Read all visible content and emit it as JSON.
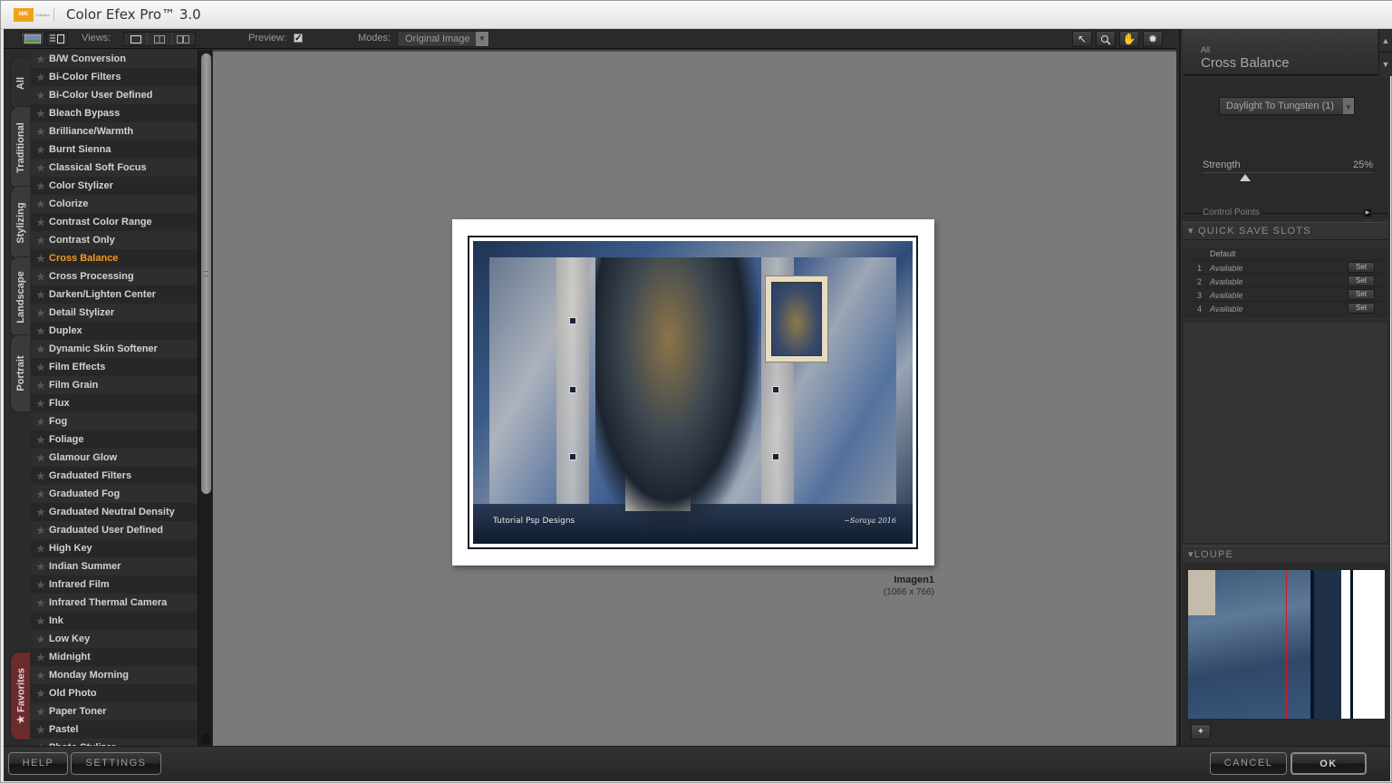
{
  "app": {
    "brand": "NIK",
    "brand_sub": "Software",
    "title": "Color Efex Pro™ 3.0"
  },
  "toolbar": {
    "views_label": "Views:",
    "preview_label": "Preview:",
    "preview_checked": true,
    "modes_label": "Modes:",
    "modes_value": "Original Image",
    "tools": [
      "pointer-tool",
      "zoom-tool",
      "hand-tool",
      "light-tool"
    ]
  },
  "vertical_tabs": [
    {
      "label": "All",
      "active": true
    },
    {
      "label": "Traditional",
      "active": false
    },
    {
      "label": "Stylizing",
      "active": false
    },
    {
      "label": "Landscape",
      "active": false
    },
    {
      "label": "Portrait",
      "active": false
    },
    {
      "label": "Favorites",
      "active": false
    }
  ],
  "filters": [
    "B/W Conversion",
    "Bi-Color Filters",
    "Bi-Color User Defined",
    "Bleach Bypass",
    "Brilliance/Warmth",
    "Burnt Sienna",
    "Classical Soft Focus",
    "Color Stylizer",
    "Colorize",
    "Contrast Color Range",
    "Contrast Only",
    "Cross Balance",
    "Cross Processing",
    "Darken/Lighten Center",
    "Detail Stylizer",
    "Duplex",
    "Dynamic Skin Softener",
    "Film Effects",
    "Film Grain",
    "Flux",
    "Fog",
    "Foliage",
    "Glamour Glow",
    "Graduated Filters",
    "Graduated Fog",
    "Graduated Neutral Density",
    "Graduated User Defined",
    "High Key",
    "Indian Summer",
    "Infrared Film",
    "Infrared Thermal Camera",
    "Ink",
    "Low Key",
    "Midnight",
    "Monday Morning",
    "Old Photo",
    "Paper Toner",
    "Pastel",
    "Photo Stylizer"
  ],
  "selected_filter": "Cross Balance",
  "canvas": {
    "image_name": "Imagen1",
    "image_dims": "(1066 x 766)",
    "credit_text": "Tutorial Psp Designs",
    "signature": "~Soraya 2016"
  },
  "right_panel": {
    "category": "All",
    "filter_title": "Cross Balance",
    "method_value": "Daylight To Tungsten (1)",
    "strength_label": "Strength",
    "strength_value": "25%",
    "strength_fraction": 0.25,
    "control_points_label": "Control Points",
    "quick_save": {
      "title": "QUICK SAVE SLOTS",
      "default_label": "Default",
      "slots": [
        {
          "num": "1",
          "state": "Available",
          "button": "Set"
        },
        {
          "num": "2",
          "state": "Available",
          "button": "Set"
        },
        {
          "num": "3",
          "state": "Available",
          "button": "Set"
        },
        {
          "num": "4",
          "state": "Available",
          "button": "Set"
        }
      ]
    },
    "loupe_title": "LOUPE"
  },
  "bottom": {
    "help": "HELP",
    "settings": "SETTINGS",
    "cancel": "CANCEL",
    "ok": "OK"
  },
  "colors": {
    "accent_selected": "#f39a1e",
    "favorites_tab": "#6b2a2c",
    "loupe_marker": "#d21c1c"
  }
}
